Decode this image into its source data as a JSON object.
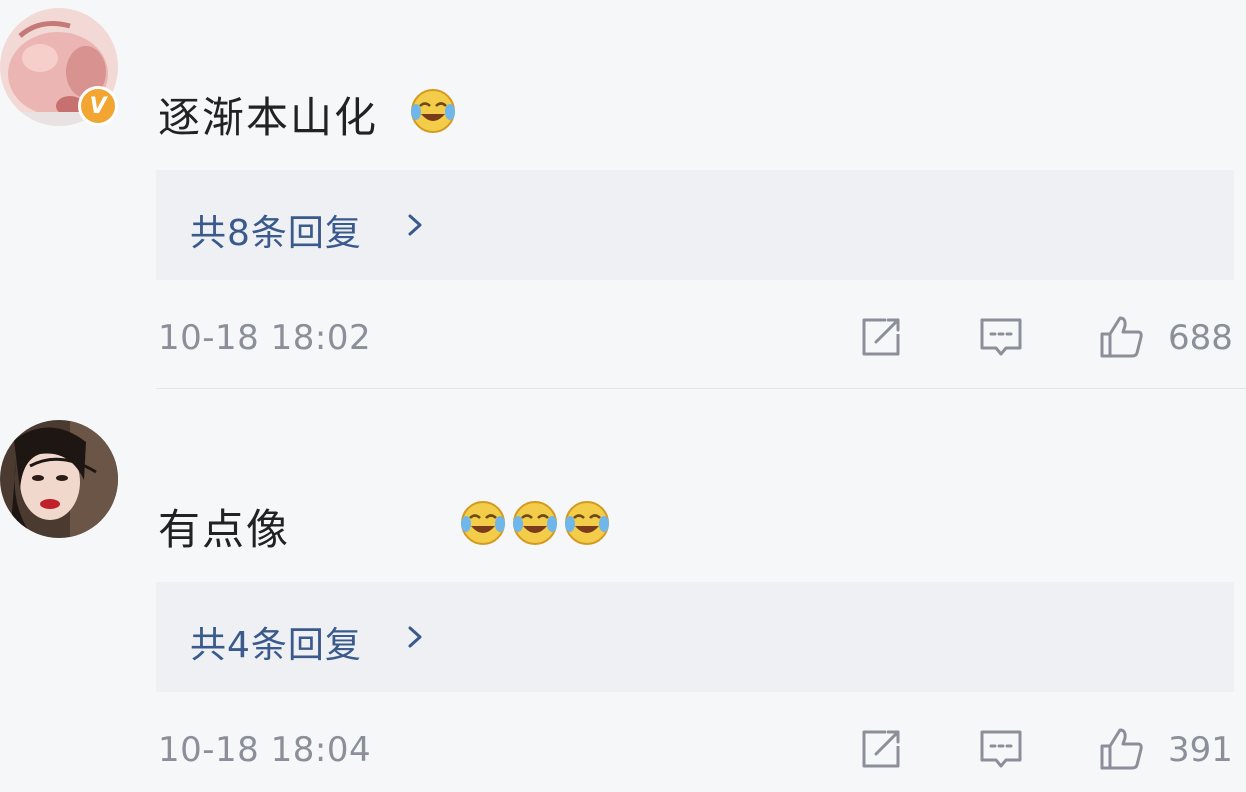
{
  "comments": [
    {
      "text": "逐渐本山化",
      "replies_label": "共8条回复",
      "timestamp": "10-18 18:02",
      "likes": "688",
      "verified_badge": "V",
      "emoji_icons": [
        "laughing-crying-emoji"
      ]
    },
    {
      "text": "有点像",
      "replies_label": "共4条回复",
      "timestamp": "10-18 18:04",
      "likes": "391",
      "emoji_icons": [
        "laughing-crying-emoji",
        "laughing-crying-emoji",
        "laughing-crying-emoji"
      ]
    }
  ],
  "icons": {
    "share": "share-icon",
    "reply": "comment-icon",
    "like": "thumbs-up-icon",
    "chevron": "chevron-right-icon"
  },
  "colors": {
    "background": "#f6f7f9",
    "reply_box": "#eef0f4",
    "link": "#3b5a8c",
    "muted": "#8b8f99",
    "text": "#222222",
    "badge": "#f2a531"
  }
}
